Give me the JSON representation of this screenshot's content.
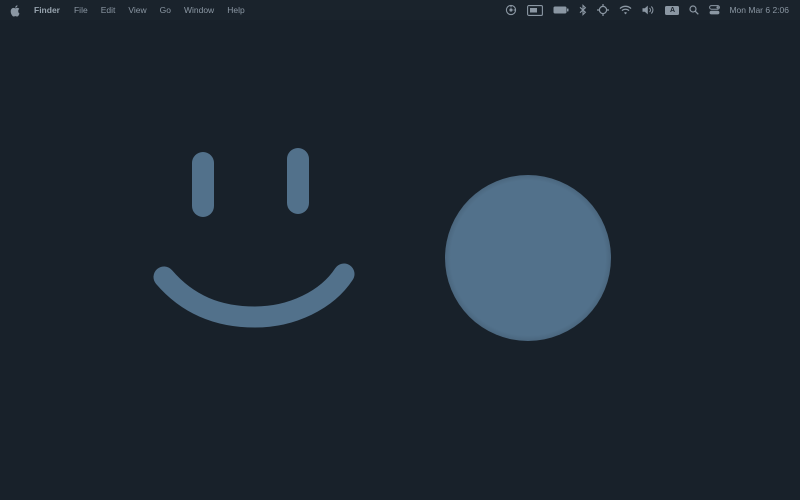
{
  "menubar": {
    "apple_icon": "apple-logo-icon",
    "app_name": "Finder",
    "menus": [
      "File",
      "Edit",
      "View",
      "Go",
      "Window",
      "Help"
    ],
    "status_icons": [
      "screen-sharing-icon",
      "display-mirroring-icon",
      "battery-icon",
      "bluetooth-icon",
      "focus-crosshair-icon",
      "wifi-icon",
      "volume-icon",
      "input-source-icon",
      "search-icon",
      "control-center-icon"
    ],
    "input_source_label": "A",
    "clock": "Mon Mar 6  2:06"
  },
  "desktop": {
    "background_color": "#18212a",
    "drawing_color": "#52718b",
    "shapes": [
      "smiley-face-drawing",
      "blurred-circle-blob"
    ]
  }
}
